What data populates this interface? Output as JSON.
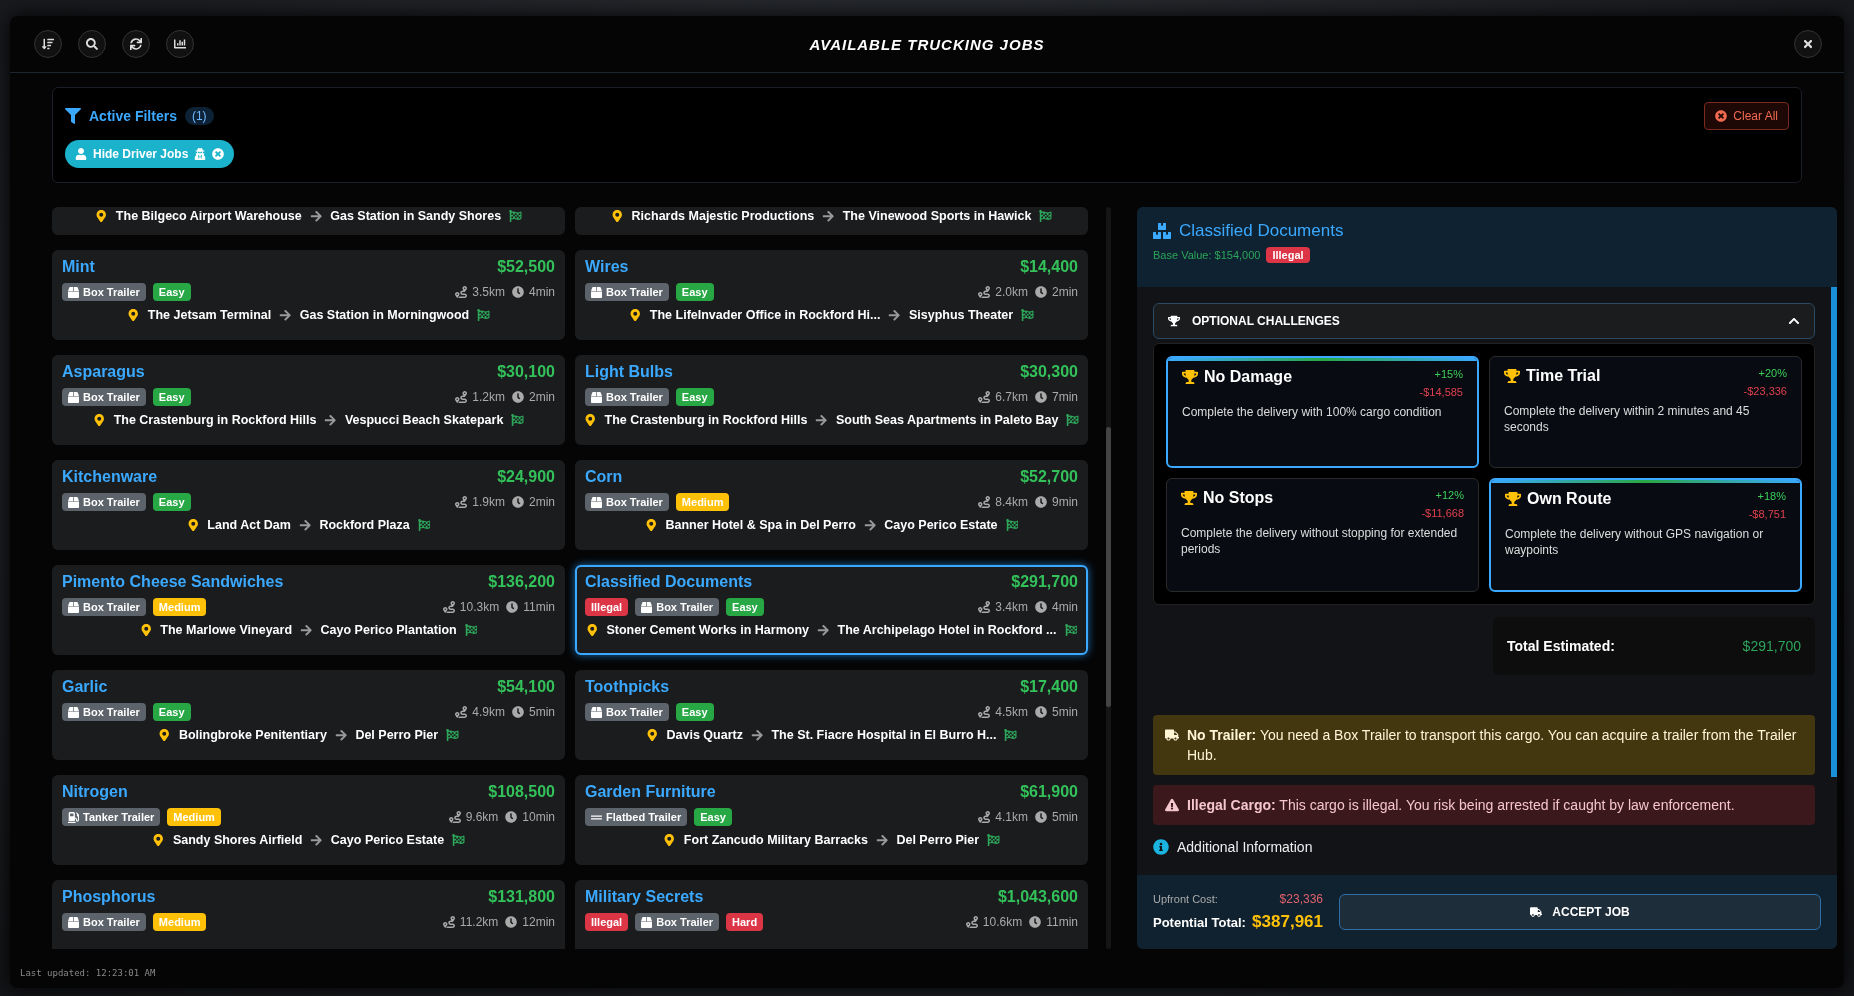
{
  "header": {
    "title": "AVAILABLE TRUCKING JOBS"
  },
  "filters": {
    "label": "Active Filters",
    "count": "(1)",
    "clear": "Clear All",
    "chips": [
      {
        "label": "Hide Driver Jobs"
      }
    ]
  },
  "jobs": [
    {
      "from": "The Bilgeco Airport Warehouse",
      "to": "Gas Station in Sandy Shores",
      "selected": false
    },
    {
      "from": "Richards Majestic Productions",
      "to": "The Vinewood Sports in Hawick",
      "selected": false
    },
    {
      "name": "Mint",
      "price": "$52,500",
      "tags": [
        {
          "label": "Box Trailer",
          "kind": "box"
        },
        {
          "label": "Easy",
          "kind": "easy"
        }
      ],
      "distance": "3.5km",
      "time": "4min",
      "from": "The Jetsam Terminal",
      "to": "Gas Station in Morningwood",
      "selected": false
    },
    {
      "name": "Wires",
      "price": "$14,400",
      "tags": [
        {
          "label": "Box Trailer",
          "kind": "box"
        },
        {
          "label": "Easy",
          "kind": "easy"
        }
      ],
      "distance": "2.0km",
      "time": "2min",
      "from": "The LifeInvader Office in Rockford Hi...",
      "to": "Sisyphus Theater",
      "selected": false
    },
    {
      "name": "Asparagus",
      "price": "$30,100",
      "tags": [
        {
          "label": "Box Trailer",
          "kind": "box"
        },
        {
          "label": "Easy",
          "kind": "easy"
        }
      ],
      "distance": "1.2km",
      "time": "2min",
      "from": "The Crastenburg in Rockford Hills",
      "to": "Vespucci Beach Skatepark",
      "selected": false
    },
    {
      "name": "Light Bulbs",
      "price": "$30,300",
      "tags": [
        {
          "label": "Box Trailer",
          "kind": "box"
        },
        {
          "label": "Easy",
          "kind": "easy"
        }
      ],
      "distance": "6.7km",
      "time": "7min",
      "from": "The Crastenburg in Rockford Hills",
      "to": "South Seas Apartments in Paleto Bay",
      "selected": false
    },
    {
      "name": "Kitchenware",
      "price": "$24,900",
      "tags": [
        {
          "label": "Box Trailer",
          "kind": "box"
        },
        {
          "label": "Easy",
          "kind": "easy"
        }
      ],
      "distance": "1.9km",
      "time": "2min",
      "from": "Land Act Dam",
      "to": "Rockford Plaza",
      "selected": false
    },
    {
      "name": "Corn",
      "price": "$52,700",
      "tags": [
        {
          "label": "Box Trailer",
          "kind": "box"
        },
        {
          "label": "Medium",
          "kind": "medium"
        }
      ],
      "distance": "8.4km",
      "time": "9min",
      "from": "Banner Hotel & Spa in Del Perro",
      "to": "Cayo Perico Estate",
      "selected": false
    },
    {
      "name": "Pimento Cheese Sandwiches",
      "price": "$136,200",
      "tags": [
        {
          "label": "Box Trailer",
          "kind": "box"
        },
        {
          "label": "Medium",
          "kind": "medium"
        }
      ],
      "distance": "10.3km",
      "time": "11min",
      "from": "The Marlowe Vineyard",
      "to": "Cayo Perico Plantation",
      "selected": false
    },
    {
      "name": "Classified Documents",
      "price": "$291,700",
      "tags": [
        {
          "label": "Illegal",
          "kind": "illegal"
        },
        {
          "label": "Box Trailer",
          "kind": "box"
        },
        {
          "label": "Easy",
          "kind": "easy"
        }
      ],
      "distance": "3.4km",
      "time": "4min",
      "from": "Stoner Cement Works in Harmony",
      "to": "The Archipelago Hotel in Rockford ...",
      "selected": true
    },
    {
      "name": "Garlic",
      "price": "$54,100",
      "tags": [
        {
          "label": "Box Trailer",
          "kind": "box"
        },
        {
          "label": "Easy",
          "kind": "easy"
        }
      ],
      "distance": "4.9km",
      "time": "5min",
      "from": "Bolingbroke Penitentiary",
      "to": "Del Perro Pier",
      "selected": false
    },
    {
      "name": "Toothpicks",
      "price": "$17,400",
      "tags": [
        {
          "label": "Box Trailer",
          "kind": "box"
        },
        {
          "label": "Easy",
          "kind": "easy"
        }
      ],
      "distance": "4.5km",
      "time": "5min",
      "from": "Davis Quartz",
      "to": "The St. Fiacre Hospital in El Burro H...",
      "selected": false
    },
    {
      "name": "Nitrogen",
      "price": "$108,500",
      "tags": [
        {
          "label": "Tanker Trailer",
          "kind": "tanker"
        },
        {
          "label": "Medium",
          "kind": "medium"
        }
      ],
      "distance": "9.6km",
      "time": "10min",
      "from": "Sandy Shores Airfield",
      "to": "Cayo Perico Estate",
      "selected": false
    },
    {
      "name": "Garden Furniture",
      "price": "$61,900",
      "tags": [
        {
          "label": "Flatbed Trailer",
          "kind": "flatbed"
        },
        {
          "label": "Easy",
          "kind": "easy"
        }
      ],
      "distance": "4.1km",
      "time": "5min",
      "from": "Fort Zancudo Military Barracks",
      "to": "Del Perro Pier",
      "selected": false
    },
    {
      "name": "Phosphorus",
      "price": "$131,800",
      "tags": [
        {
          "label": "Box Trailer",
          "kind": "box"
        },
        {
          "label": "Medium",
          "kind": "medium"
        }
      ],
      "distance": "11.2km",
      "time": "12min",
      "selected": false
    },
    {
      "name": "Military Secrets",
      "price": "$1,043,600",
      "tags": [
        {
          "label": "Illegal",
          "kind": "illegal"
        },
        {
          "label": "Box Trailer",
          "kind": "box"
        },
        {
          "label": "Hard",
          "kind": "hard"
        }
      ],
      "distance": "10.6km",
      "time": "11min",
      "selected": false
    }
  ],
  "detail": {
    "title": "Classified Documents",
    "base_value": "Base Value: $154,000",
    "badge": "Illegal",
    "challenges": {
      "title": "OPTIONAL CHALLENGES",
      "expanded": true,
      "items": [
        {
          "name": "No Damage",
          "bonus": "+15%",
          "cost": "-$14,585",
          "description": "Complete the delivery with 100% cargo condition",
          "selected": true
        },
        {
          "name": "Time Trial",
          "bonus": "+20%",
          "cost": "-$23,336",
          "description": "Complete the delivery within 2 minutes and 45 seconds",
          "selected": false
        },
        {
          "name": "No Stops",
          "bonus": "+12%",
          "cost": "-$11,668",
          "description": "Complete the delivery without stopping for extended periods",
          "selected": false
        },
        {
          "name": "Own Route",
          "bonus": "+18%",
          "cost": "-$8,751",
          "description": "Complete the delivery without GPS navigation or waypoints",
          "selected": true
        }
      ]
    },
    "total_label": "Total Estimated:",
    "total": "$291,700",
    "alerts": [
      {
        "kind": "warning",
        "text": "**No Trailer:** You need a Box Trailer to transport this cargo. You can acquire a trailer from the Trailer Hub."
      },
      {
        "kind": "danger",
        "text": "**Illegal Cargo:** This cargo is illegal. You risk being arrested if caught by law enforcement."
      }
    ],
    "additional": "Additional Information",
    "upfront_label": "Upfront Cost:",
    "upfront": "$23,336",
    "potential_label": "Potential Total:",
    "potential": "$387,961",
    "accept": "ACCEPT JOB"
  },
  "status": "Last updated: 12:23:01 AM"
}
